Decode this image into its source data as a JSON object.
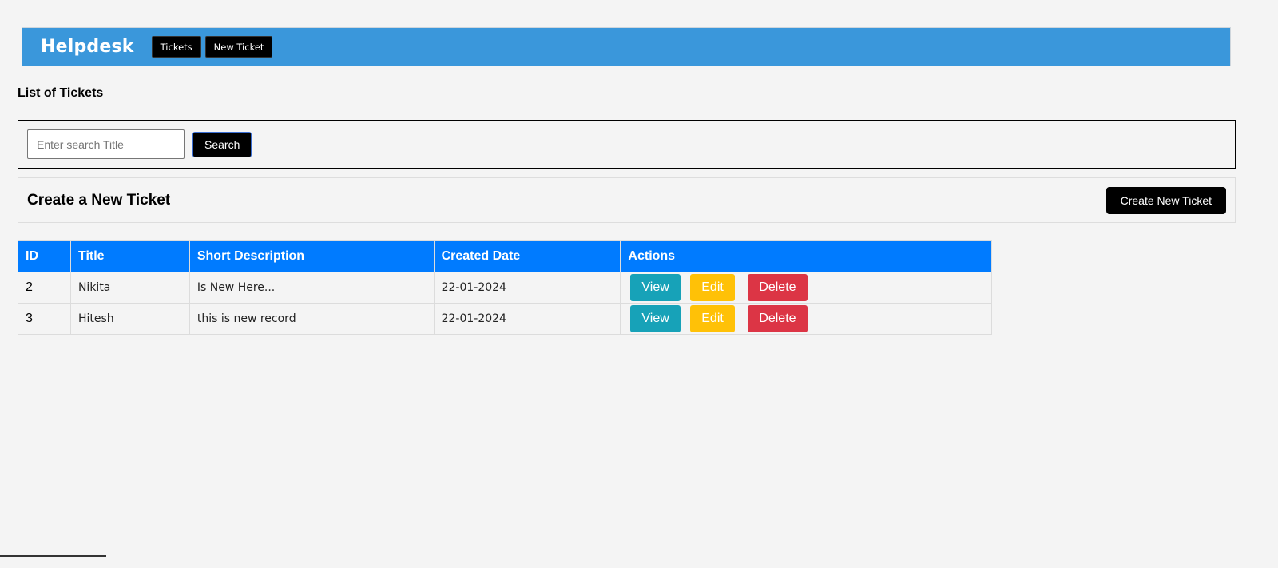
{
  "navbar": {
    "brand": "Helpdesk",
    "links": [
      "Tickets",
      "New Ticket"
    ]
  },
  "page": {
    "heading": "List of Tickets"
  },
  "search": {
    "placeholder": "Enter search Title",
    "value": "",
    "button_label": "Search"
  },
  "create": {
    "title": "Create a New Ticket",
    "button_label": "Create New Ticket"
  },
  "table": {
    "columns": [
      "ID",
      "Title",
      "Short Description",
      "Created Date",
      "Actions"
    ],
    "rows": [
      {
        "id": "2",
        "title": "Nikita",
        "short_description": "Is New Here...",
        "created_date": "22-01-2024"
      },
      {
        "id": "3",
        "title": "Hitesh",
        "short_description": "this is new record",
        "created_date": "22-01-2024"
      }
    ],
    "actions": {
      "view": "View",
      "edit": "Edit",
      "delete": "Delete"
    }
  },
  "colors": {
    "navbar": "#3a97db",
    "table_header": "#007bff",
    "view": "#17a2b8",
    "edit": "#ffc107",
    "delete": "#dc3545"
  }
}
